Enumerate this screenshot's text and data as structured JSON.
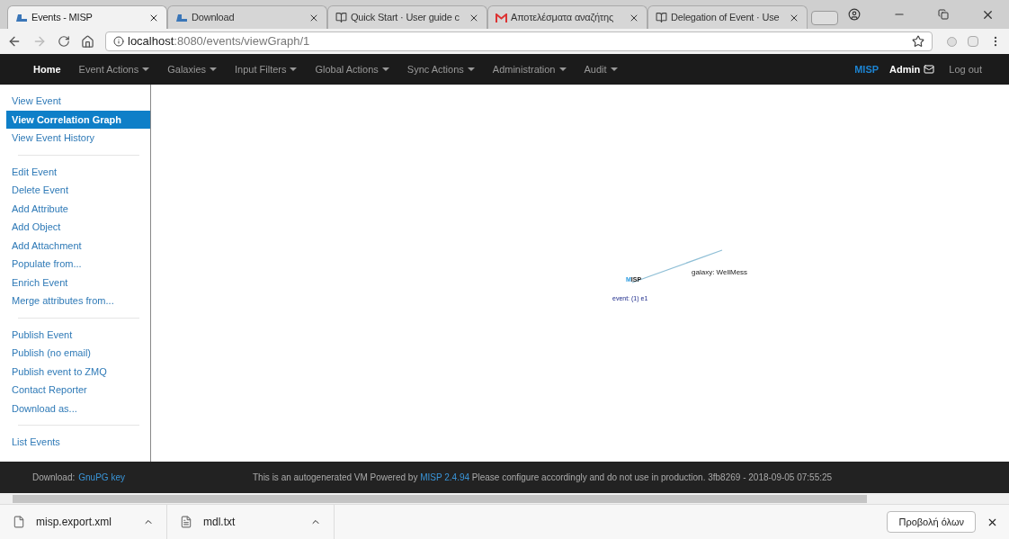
{
  "browser": {
    "tabs": [
      {
        "title": "Events - MISP",
        "selected": true,
        "kind": "misp"
      },
      {
        "title": "Download",
        "selected": false,
        "kind": "misp"
      },
      {
        "title": "Quick Start · User guide c",
        "selected": false,
        "kind": "book"
      },
      {
        "title": "Αποτελέσματα αναζήτης",
        "selected": false,
        "kind": "gmail"
      },
      {
        "title": "Delegation of Event · Use",
        "selected": false,
        "kind": "book"
      }
    ],
    "address": {
      "host": "localhost",
      "rest": ":8080/events/viewGraph/1"
    }
  },
  "navbar": {
    "items": [
      {
        "label": "Home",
        "dropdown": false,
        "selected": true
      },
      {
        "label": "Event Actions",
        "dropdown": true,
        "selected": false
      },
      {
        "label": "Galaxies",
        "dropdown": true,
        "selected": false
      },
      {
        "label": "Input Filters",
        "dropdown": true,
        "selected": false
      },
      {
        "label": "Global Actions",
        "dropdown": true,
        "selected": false
      },
      {
        "label": "Sync Actions",
        "dropdown": true,
        "selected": false
      },
      {
        "label": "Administration",
        "dropdown": true,
        "selected": false
      },
      {
        "label": "Audit",
        "dropdown": true,
        "selected": false
      }
    ],
    "brand": "MISP",
    "user": "Admin",
    "logout": "Log out"
  },
  "sidebar": {
    "groups": [
      [
        {
          "label": "View Event",
          "selected": false
        },
        {
          "label": "View Correlation Graph",
          "selected": true
        },
        {
          "label": "View Event History",
          "selected": false
        }
      ],
      [
        {
          "label": "Edit Event",
          "selected": false
        },
        {
          "label": "Delete Event",
          "selected": false
        },
        {
          "label": "Add Attribute",
          "selected": false
        },
        {
          "label": "Add Object",
          "selected": false
        },
        {
          "label": "Add Attachment",
          "selected": false
        },
        {
          "label": "Populate from...",
          "selected": false
        },
        {
          "label": "Enrich Event",
          "selected": false
        },
        {
          "label": "Merge attributes from...",
          "selected": false
        }
      ],
      [
        {
          "label": "Publish Event",
          "selected": false
        },
        {
          "label": "Publish (no email)",
          "selected": false
        },
        {
          "label": "Publish event to ZMQ",
          "selected": false
        },
        {
          "label": "Contact Reporter",
          "selected": false
        },
        {
          "label": "Download as...",
          "selected": false
        }
      ],
      [
        {
          "label": "List Events",
          "selected": false
        }
      ]
    ]
  },
  "graph": {
    "event_label": "MISP",
    "event_caption": "event: (1) e1",
    "galaxy_label": "galaxy: WellMess"
  },
  "footer": {
    "download_label": "Download:",
    "download_link": "GnuPG key",
    "notice_before": "This is an autogenerated VM Powered by",
    "notice_link": "MISP 2.4.94",
    "notice_after": "Please configure accordingly and do not use in production. 3fb8269 - 2018-09-05 07:55:25"
  },
  "downloads": {
    "files": [
      {
        "name": "misp.export.xml"
      },
      {
        "name": "mdl.txt"
      }
    ],
    "show_all": "Προβολή όλων"
  }
}
